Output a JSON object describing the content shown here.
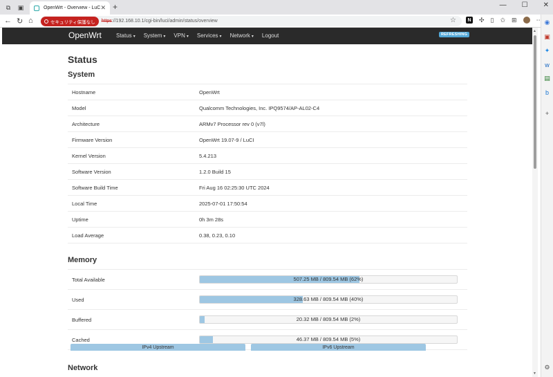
{
  "browser": {
    "tab_title": "OpenWrt - Overview - LuCI",
    "tab_close": "✕",
    "new_tab": "+",
    "security_label": "セキュリティ保護なし",
    "url_scheme": "https",
    "url_rest": "://192.168.10.1/cgi-bin/luci/admin/status/overview",
    "win_min": "—",
    "win_max": "☐",
    "win_close": "✕"
  },
  "navbar": {
    "brand": "OpenWrt",
    "menu": [
      {
        "label": "Status",
        "caret": "▾"
      },
      {
        "label": "System",
        "caret": "▾"
      },
      {
        "label": "VPN",
        "caret": "▾"
      },
      {
        "label": "Services",
        "caret": "▾"
      },
      {
        "label": "Network",
        "caret": "▾"
      },
      {
        "label": "Logout",
        "caret": ""
      }
    ],
    "badge": "REFRESHING"
  },
  "page": {
    "title": "Status",
    "system_title": "System",
    "memory_title": "Memory",
    "network_title": "Network"
  },
  "system": [
    {
      "key": "Hostname",
      "value": "OpenWrt"
    },
    {
      "key": "Model",
      "value": "Qualcomm Technologies, Inc. IPQ9574/AP-AL02-C4"
    },
    {
      "key": "Architecture",
      "value": "ARMv7 Processor rev 0 (v7l)"
    },
    {
      "key": "Firmware Version",
      "value": "OpenWrt 19.07-9 / LuCI"
    },
    {
      "key": "Kernel Version",
      "value": "5.4.213"
    },
    {
      "key": "Software Version",
      "value": "1.2.0 Build 15"
    },
    {
      "key": "Software Build Time",
      "value": "Fri Aug 16 02:25:30 UTC 2024"
    },
    {
      "key": "Local Time",
      "value": "2025-07-01 17:50:54"
    },
    {
      "key": "Uptime",
      "value": "0h 3m 28s"
    },
    {
      "key": "Load Average",
      "value": "0.38, 0.23, 0.10"
    }
  ],
  "memory": [
    {
      "key": "Total Available",
      "text": "507.25 MB / 809.54 MB (62%)",
      "fraction": 0.62
    },
    {
      "key": "Used",
      "text": "328.63 MB / 809.54 MB (40%)",
      "fraction": 0.4
    },
    {
      "key": "Buffered",
      "text": "20.32 MB / 809.54 MB (2%)",
      "fraction": 0.02
    },
    {
      "key": "Cached",
      "text": "46.37 MB / 809.54 MB (5%)",
      "fraction": 0.05
    }
  ],
  "network": {
    "ipv4_upstream": "IPv4 Upstream",
    "ipv6_upstream": "IPv6 Upstream"
  },
  "colors": {
    "navbar_bg": "#2a2a2a",
    "badge_bg": "#53a8d7",
    "bar_fill": "#9ec7e3",
    "security_red": "#c5221f"
  }
}
